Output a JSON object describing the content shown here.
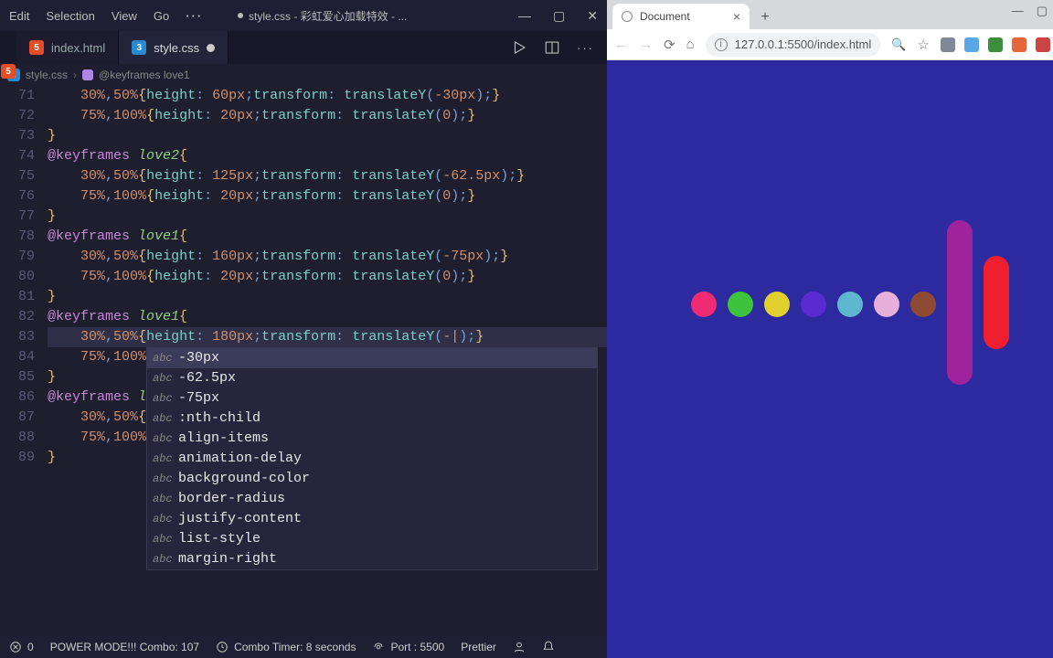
{
  "menu": {
    "edit": "Edit",
    "selection": "Selection",
    "view": "View",
    "go": "Go"
  },
  "windowTitle": "style.css - 彩虹爱心加载特效 - ...",
  "tabs": [
    {
      "icon": "html",
      "label": "index.html",
      "active": false,
      "dirty": false
    },
    {
      "icon": "css",
      "label": "style.css",
      "active": true,
      "dirty": true
    }
  ],
  "breadcrumb": {
    "file": "style.css",
    "symbol": "@keyframes love1"
  },
  "code": {
    "startLine": 71,
    "lines": [
      "    30%,50%{height: 60px;transform: translateY(-30px);}",
      "    75%,100%{height: 20px;transform: translateY(0);}",
      "}",
      "@keyframes love2{",
      "    30%,50%{height: 125px;transform: translateY(-62.5px);}",
      "    75%,100%{height: 20px;transform: translateY(0);}",
      "}",
      "@keyframes love1{",
      "    30%,50%{height: 160px;transform: translateY(-75px);}",
      "    75%,100%{height: 20px;transform: translateY(0);}",
      "}",
      "@keyframes love1{",
      "    30%,50%{height: 180px;transform: translateY(-|);}",
      "    75%,100%",
      "}",
      "@keyframes l",
      "    30%,50%{",
      "    75%,100%",
      "}"
    ]
  },
  "suggest": {
    "items": [
      "-30px",
      "-62.5px",
      "-75px",
      ":nth-child",
      "align-items",
      "animation-delay",
      "background-color",
      "border-radius",
      "justify-content",
      "list-style",
      "margin-right"
    ],
    "selected": 0,
    "iconLabel": "abc"
  },
  "status": {
    "errors": "0",
    "powerMode": "POWER MODE!!! Combo: 107",
    "comboTimer": "Combo Timer: 8 seconds",
    "port": "Port : 5500",
    "prettier": "Prettier"
  },
  "browser": {
    "tabTitle": "Document",
    "url": "127.0.0.1:5500/index.html",
    "extColors": [
      "#7e8897",
      "#5aa6e6",
      "#3c8d3c",
      "#e6663c",
      "#cc4444",
      "#5e9f6b"
    ],
    "previewBg": "#2d2aa0",
    "dots": [
      "#ee2b73",
      "#3ec43c",
      "#e0d02e",
      "#5a2bd0",
      "#5fb7cf",
      "#e7b0da",
      "#8f4a33"
    ],
    "bar1Color": "#a0239e",
    "bar2Color": "#ef1f2f"
  }
}
